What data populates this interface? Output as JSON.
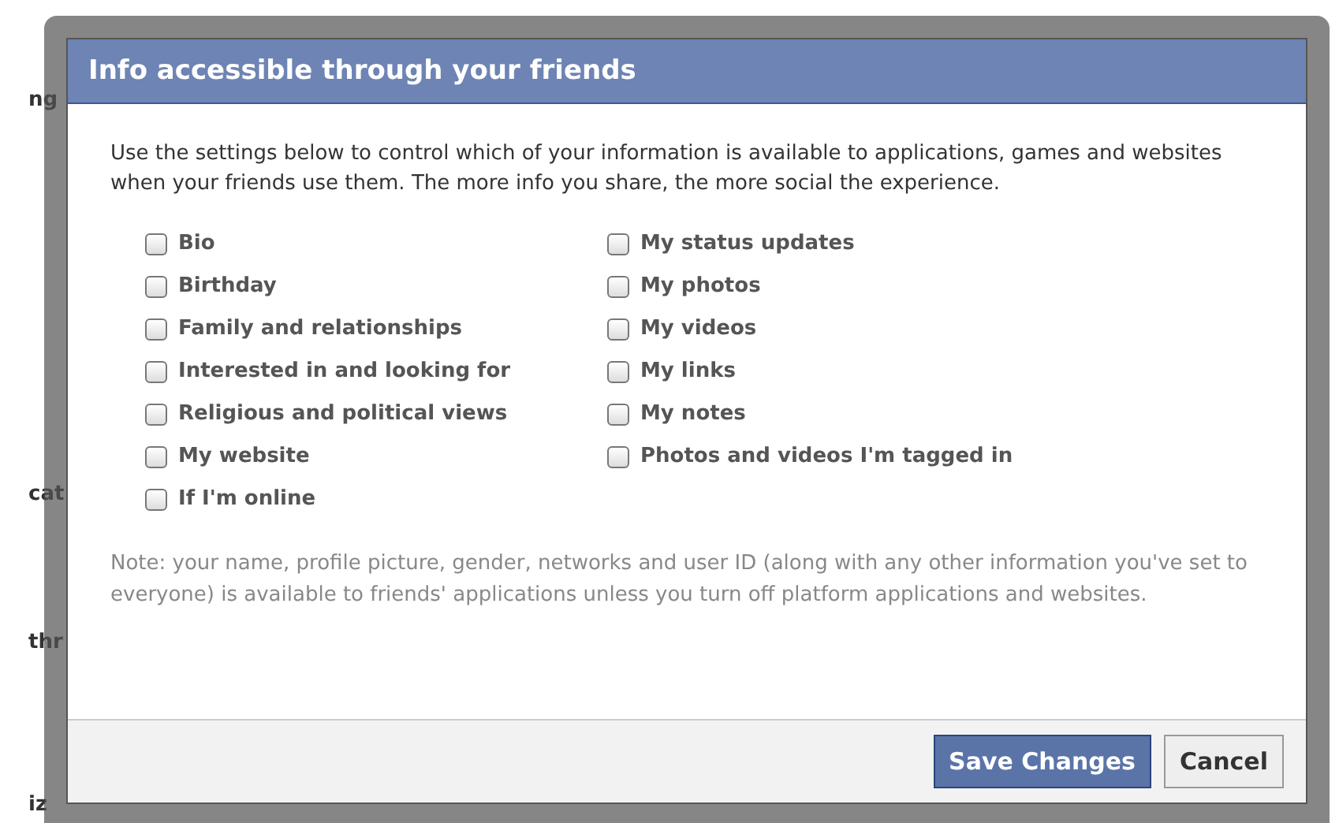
{
  "background_fragments": [
    {
      "text": "ng"
    },
    {
      "text": "cat"
    },
    {
      "text": "thr"
    },
    {
      "text": "iz"
    }
  ],
  "dialog": {
    "title": "Info accessible through your friends",
    "intro": "Use the settings below to control which of your information is available to applications, games and websites when your friends use them. The more info you share, the more social the experience.",
    "columns": [
      [
        {
          "label": "Bio",
          "checked": false
        },
        {
          "label": "Birthday",
          "checked": false
        },
        {
          "label": "Family and relationships",
          "checked": false
        },
        {
          "label": "Interested in and looking for",
          "checked": false
        },
        {
          "label": "Religious and political views",
          "checked": false
        },
        {
          "label": "My website",
          "checked": false
        },
        {
          "label": "If I'm online",
          "checked": false
        }
      ],
      [
        {
          "label": "My status updates",
          "checked": false
        },
        {
          "label": "My photos",
          "checked": false
        },
        {
          "label": "My videos",
          "checked": false
        },
        {
          "label": "My links",
          "checked": false
        },
        {
          "label": "My notes",
          "checked": false
        },
        {
          "label": "Photos and videos I'm tagged in",
          "checked": false
        }
      ]
    ],
    "note": "Note: your name, profile picture, gender, networks and user ID (along with any other information you've set to everyone) is available to friends' applications unless you turn off platform applications and websites.",
    "buttons": [
      {
        "label": "Save Changes",
        "kind": "primary"
      },
      {
        "label": "Cancel",
        "kind": "secondary"
      }
    ]
  }
}
